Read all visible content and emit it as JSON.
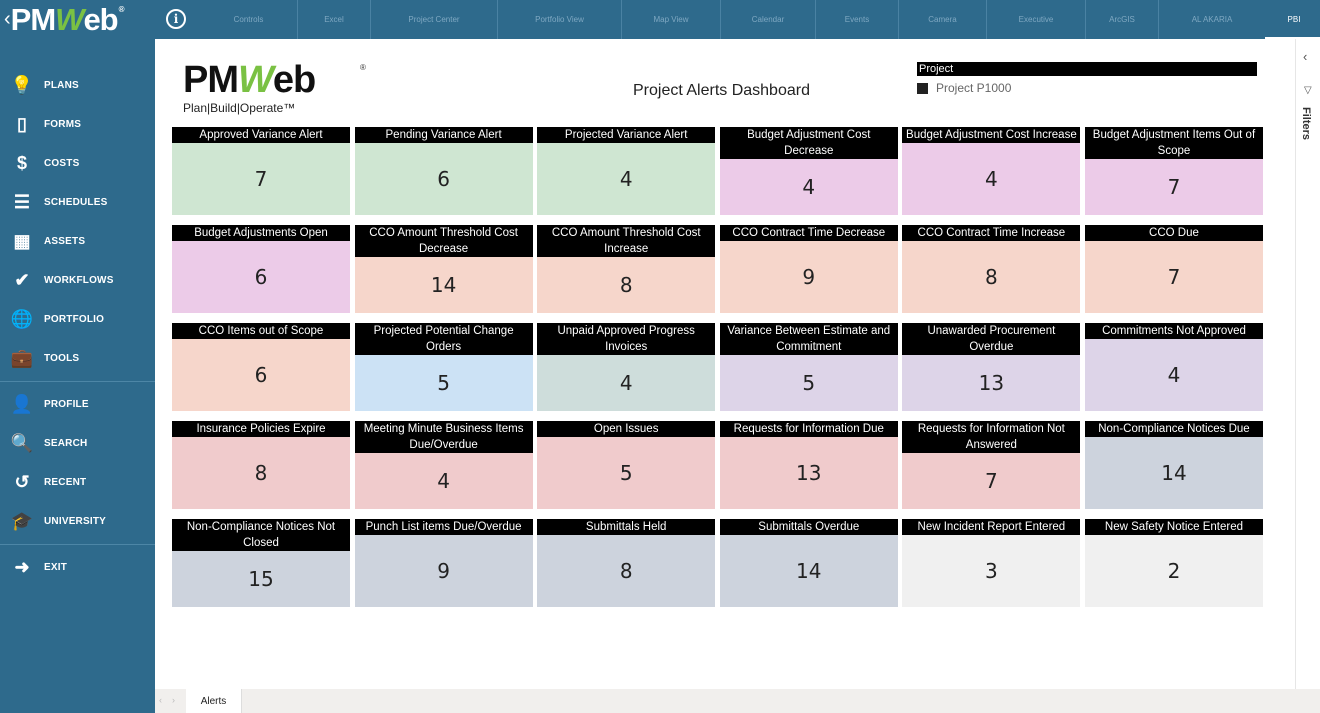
{
  "app": {
    "logo_prefix": "PM",
    "logo_w": "W",
    "logo_suffix": "eb",
    "logo_reg": "®",
    "back_chevron": "‹",
    "info_icon": "i"
  },
  "nav_tabs": [
    {
      "label": "Controls",
      "active": false
    },
    {
      "label": "Excel",
      "active": false
    },
    {
      "label": "Project Center",
      "active": false
    },
    {
      "label": "Portfolio View",
      "active": false
    },
    {
      "label": "Map View",
      "active": false
    },
    {
      "label": "Calendar",
      "active": false
    },
    {
      "label": "Events",
      "active": false
    },
    {
      "label": "Camera",
      "active": false
    },
    {
      "label": "Executive",
      "active": false
    },
    {
      "label": "ArcGIS",
      "active": false
    },
    {
      "label": "AL AKARIA",
      "active": false
    },
    {
      "label": "PBI",
      "active": true
    }
  ],
  "sidebar": {
    "groups": [
      [
        {
          "label": "PLANS",
          "icon": "lightbulb-icon",
          "glyph": "💡"
        },
        {
          "label": "FORMS",
          "icon": "document-icon",
          "glyph": "▯"
        },
        {
          "label": "COSTS",
          "icon": "dollar-icon",
          "glyph": "$"
        },
        {
          "label": "SCHEDULES",
          "icon": "gantt-icon",
          "glyph": "☰"
        },
        {
          "label": "ASSETS",
          "icon": "building-icon",
          "glyph": "▦"
        },
        {
          "label": "WORKFLOWS",
          "icon": "checkmark-icon",
          "glyph": "✔"
        },
        {
          "label": "PORTFOLIO",
          "icon": "globe-icon",
          "glyph": "🌐"
        },
        {
          "label": "TOOLS",
          "icon": "toolbox-icon",
          "glyph": "💼"
        }
      ],
      [
        {
          "label": "PROFILE",
          "icon": "user-icon",
          "glyph": "👤"
        },
        {
          "label": "SEARCH",
          "icon": "search-icon",
          "glyph": "🔍"
        },
        {
          "label": "RECENT",
          "icon": "history-icon",
          "glyph": "↺"
        },
        {
          "label": "UNIVERSITY",
          "icon": "graduation-cap-icon",
          "glyph": "🎓"
        }
      ],
      [
        {
          "label": "EXIT",
          "icon": "exit-icon",
          "glyph": "➜"
        }
      ]
    ]
  },
  "report": {
    "logo_main_prefix": "PM",
    "logo_main_w": "W",
    "logo_main_suffix": "eb",
    "logo_reg": "®",
    "logo_tagline": "Plan|Build|Operate™",
    "title": "Project Alerts Dashboard",
    "filter": {
      "header": "Project",
      "option": "Project P1000"
    }
  },
  "alerts": [
    {
      "title": "Approved Variance Alert",
      "value": "7",
      "color": "#cfe6d2"
    },
    {
      "title": "Pending Variance Alert",
      "value": "6",
      "color": "#cfe6d2"
    },
    {
      "title": "Projected Variance Alert",
      "value": "4",
      "color": "#cfe6d2"
    },
    {
      "title": "Budget Adjustment Cost Decrease",
      "value": "4",
      "color": "#eccbe8"
    },
    {
      "title": "Budget Adjustment Cost Increase",
      "value": "4",
      "color": "#eccbe8"
    },
    {
      "title": "Budget Adjustment Items Out of Scope",
      "value": "7",
      "color": "#eccbe8"
    },
    {
      "title": "Budget Adjustments Open",
      "value": "6",
      "color": "#eccbe8"
    },
    {
      "title": "CCO Amount Threshold Cost Decrease",
      "value": "14",
      "color": "#f6d6cb"
    },
    {
      "title": "CCO Amount Threshold Cost Increase",
      "value": "8",
      "color": "#f6d6cb"
    },
    {
      "title": "CCO Contract Time Decrease",
      "value": "9",
      "color": "#f6d6cb"
    },
    {
      "title": "CCO Contract Time Increase",
      "value": "8",
      "color": "#f6d6cb"
    },
    {
      "title": "CCO Due",
      "value": "7",
      "color": "#f6d6cb"
    },
    {
      "title": "CCO Items out of Scope",
      "value": "6",
      "color": "#f6d6cb"
    },
    {
      "title": "Projected Potential Change Orders",
      "value": "5",
      "color": "#cce2f5"
    },
    {
      "title": "Unpaid Approved Progress Invoices",
      "value": "4",
      "color": "#cedddb"
    },
    {
      "title": "Variance Between Estimate and Commitment",
      "value": "5",
      "color": "#ddd4e8"
    },
    {
      "title": "Unawarded Procurement Overdue",
      "value": "13",
      "color": "#ddd4e8"
    },
    {
      "title": "Commitments Not Approved",
      "value": "4",
      "color": "#ddd4e8"
    },
    {
      "title": "Insurance Policies Expire",
      "value": "8",
      "color": "#f0cbcc"
    },
    {
      "title": "Meeting Minute Business Items Due/Overdue",
      "value": "4",
      "color": "#f0cbcc"
    },
    {
      "title": "Open Issues",
      "value": "5",
      "color": "#f0cbcc"
    },
    {
      "title": "Requests for Information Due",
      "value": "13",
      "color": "#f0cbcc"
    },
    {
      "title": "Requests for Information Not Answered",
      "value": "7",
      "color": "#f0cbcc"
    },
    {
      "title": "Non-Compliance Notices Due",
      "value": "14",
      "color": "#cdd3dd"
    },
    {
      "title": "Non-Compliance Notices Not Closed",
      "value": "15",
      "color": "#cdd3dd"
    },
    {
      "title": "Punch List items Due/Overdue",
      "value": "9",
      "color": "#cdd3dd"
    },
    {
      "title": "Submittals Held",
      "value": "8",
      "color": "#cdd3dd"
    },
    {
      "title": "Submittals Overdue",
      "value": "14",
      "color": "#cdd3dd"
    },
    {
      "title": "New Incident Report Entered",
      "value": "3",
      "color": "#f0f0f0"
    },
    {
      "title": "New Safety Notice Entered",
      "value": "2",
      "color": "#f0f0f0"
    }
  ],
  "right_panel": {
    "collapse_glyph": "‹",
    "filter_glyph": "▽",
    "label": "Filters"
  },
  "bottom": {
    "prev_glyph": "‹",
    "next_glyph": "›",
    "page_tab": "Alerts"
  }
}
